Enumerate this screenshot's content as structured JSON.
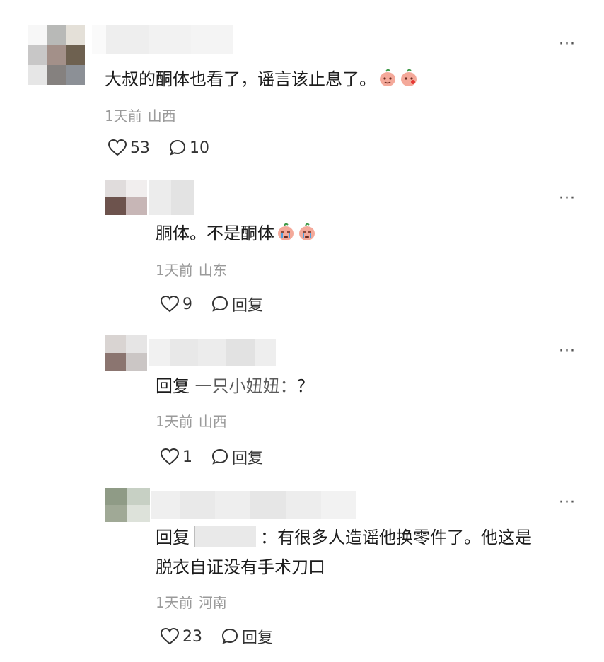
{
  "comments": [
    {
      "text": "大叔的酮体也看了，谣言该止息了。",
      "emojis": [
        "peach-emoji",
        "peach-emoji"
      ],
      "meta": {
        "time": "1天前",
        "location": "山西"
      },
      "likes": "53",
      "replies": "10"
    },
    {
      "text": "胴体。不是酮体",
      "emojis": [
        "peach-cry-emoji",
        "peach-cry-emoji"
      ],
      "meta": {
        "time": "1天前",
        "location": "山东"
      },
      "likes": "9",
      "reply_label": "回复"
    },
    {
      "reply_prefix": "回复",
      "reply_target": "一只小妞妞：",
      "text": "？",
      "meta": {
        "time": "1天前",
        "location": "山西"
      },
      "likes": "1",
      "reply_label": "回复"
    },
    {
      "reply_prefix": "回复",
      "line1": "：有很多人造谣他换零件了。他这是",
      "line2": "脱衣自证没有手术刀口",
      "meta": {
        "time": "1天前",
        "location": "河南"
      },
      "likes": "23",
      "reply_label": "回复"
    }
  ],
  "more_label": "···",
  "colors": {
    "text": "#1c1c1c",
    "meta": "#9a9a9a",
    "icon": "#333333"
  }
}
